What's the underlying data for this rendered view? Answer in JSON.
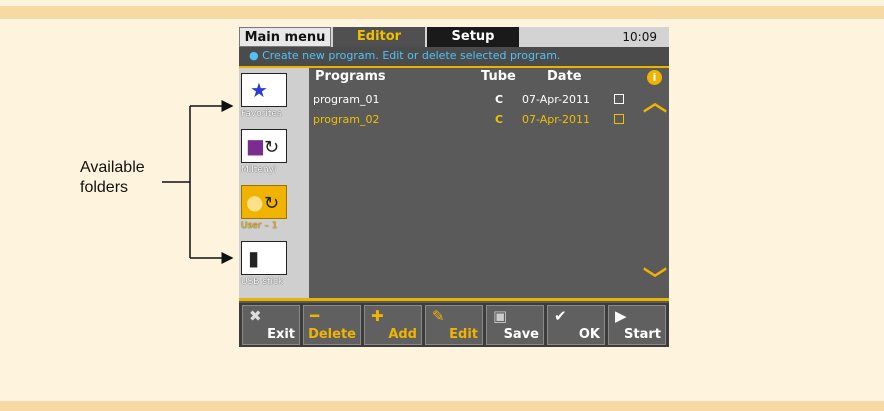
{
  "annotation": {
    "line1": "Available",
    "line2": "folders"
  },
  "device": {
    "tabs": [
      {
        "label": "Main menu"
      },
      {
        "label": "Editor"
      },
      {
        "label": "Setup"
      }
    ],
    "clock": "10:09",
    "info_text": "● Create new program. Edit or delete selected program.",
    "folders": [
      {
        "label": "Favorites",
        "icon": "star-folder-icon"
      },
      {
        "label": "Miltenyi",
        "icon": "lock-refresh-icon"
      },
      {
        "label": "User – 1",
        "icon": "user-folder-icon"
      },
      {
        "label": "USB stick",
        "icon": "usb-stick-icon"
      }
    ],
    "columns": {
      "programs": "Programs",
      "tube": "Tube",
      "date": "Date"
    },
    "programs": [
      {
        "name": "program_01",
        "tube": "C",
        "date": "07-Apr-2011"
      },
      {
        "name": "program_02",
        "tube": "C",
        "date": "07-Apr-2011"
      }
    ],
    "info_icon": "i",
    "buttons": [
      {
        "label": "Exit"
      },
      {
        "label": "Delete"
      },
      {
        "label": "Add"
      },
      {
        "label": "Edit"
      },
      {
        "label": "Save"
      },
      {
        "label": "OK"
      },
      {
        "label": "Start"
      }
    ],
    "colors": {
      "accent": "#f0b400",
      "info_text": "#4fc3f7",
      "panel": "#5a5a5a"
    }
  }
}
